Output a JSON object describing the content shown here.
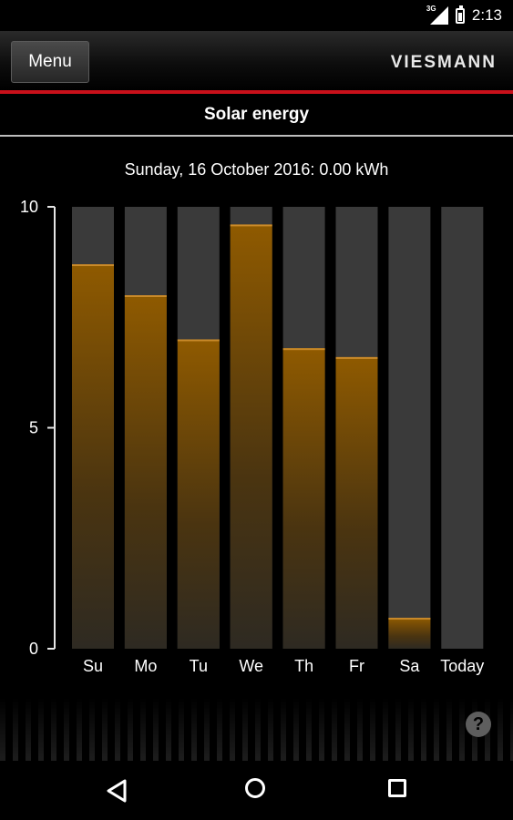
{
  "status_bar": {
    "network": "3G",
    "time": "2:13"
  },
  "header": {
    "menu_label": "Menu",
    "brand": "VIESMANN"
  },
  "page_title": "Solar energy",
  "summary": "Sunday, 16 October 2016: 0.00 kWh",
  "help_label": "?",
  "chart_data": {
    "type": "bar",
    "categories": [
      "Su",
      "Mo",
      "Tu",
      "We",
      "Th",
      "Fr",
      "Sa",
      "Today"
    ],
    "values": [
      8.7,
      8.0,
      7.0,
      9.6,
      6.8,
      6.6,
      0.7,
      0
    ],
    "ylim": [
      0,
      10
    ],
    "yticks": [
      "0",
      "5",
      "10"
    ],
    "bar_color": "#8a5500",
    "track_color": "#3a3a3a"
  }
}
